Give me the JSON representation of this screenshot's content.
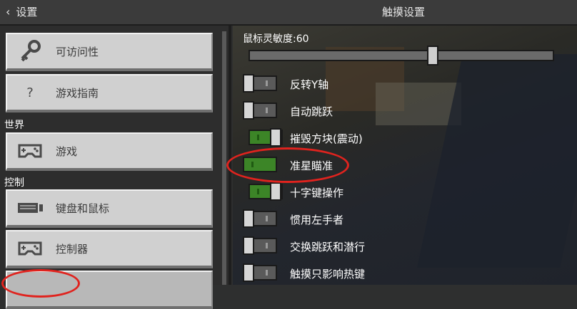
{
  "header": {
    "back_label": "设置",
    "title": "触摸设置"
  },
  "sidebar": {
    "items": [
      {
        "label": "可访问性",
        "icon": "key-icon"
      },
      {
        "label": "游戏指南",
        "icon": "question-icon"
      }
    ],
    "sections": [
      {
        "title": "世界",
        "items": [
          {
            "label": "游戏",
            "icon": "gamepad-icon"
          }
        ]
      },
      {
        "title": "控制",
        "items": [
          {
            "label": "键盘和鼠标",
            "icon": "keyboard-icon"
          },
          {
            "label": "控制器",
            "icon": "gamepad-icon"
          }
        ]
      }
    ]
  },
  "main": {
    "sensitivity": {
      "label": "鼠标灵敏度:60",
      "value": 60,
      "max": 100
    },
    "toggles": [
      {
        "label": "反转Y轴",
        "on": false
      },
      {
        "label": "自动跳跃",
        "on": false
      },
      {
        "label": "摧毁方块(震动)",
        "on": true
      },
      {
        "label": "准星瞄准",
        "on": true
      },
      {
        "label": "十字键操作",
        "on": true
      },
      {
        "label": "惯用左手者",
        "on": false
      },
      {
        "label": "交换跳跃和潜行",
        "on": false
      },
      {
        "label": "触摸只影响热键",
        "on": false
      }
    ]
  },
  "colors": {
    "toggle_on": "#3c8527",
    "annotation": "#e0231e"
  }
}
